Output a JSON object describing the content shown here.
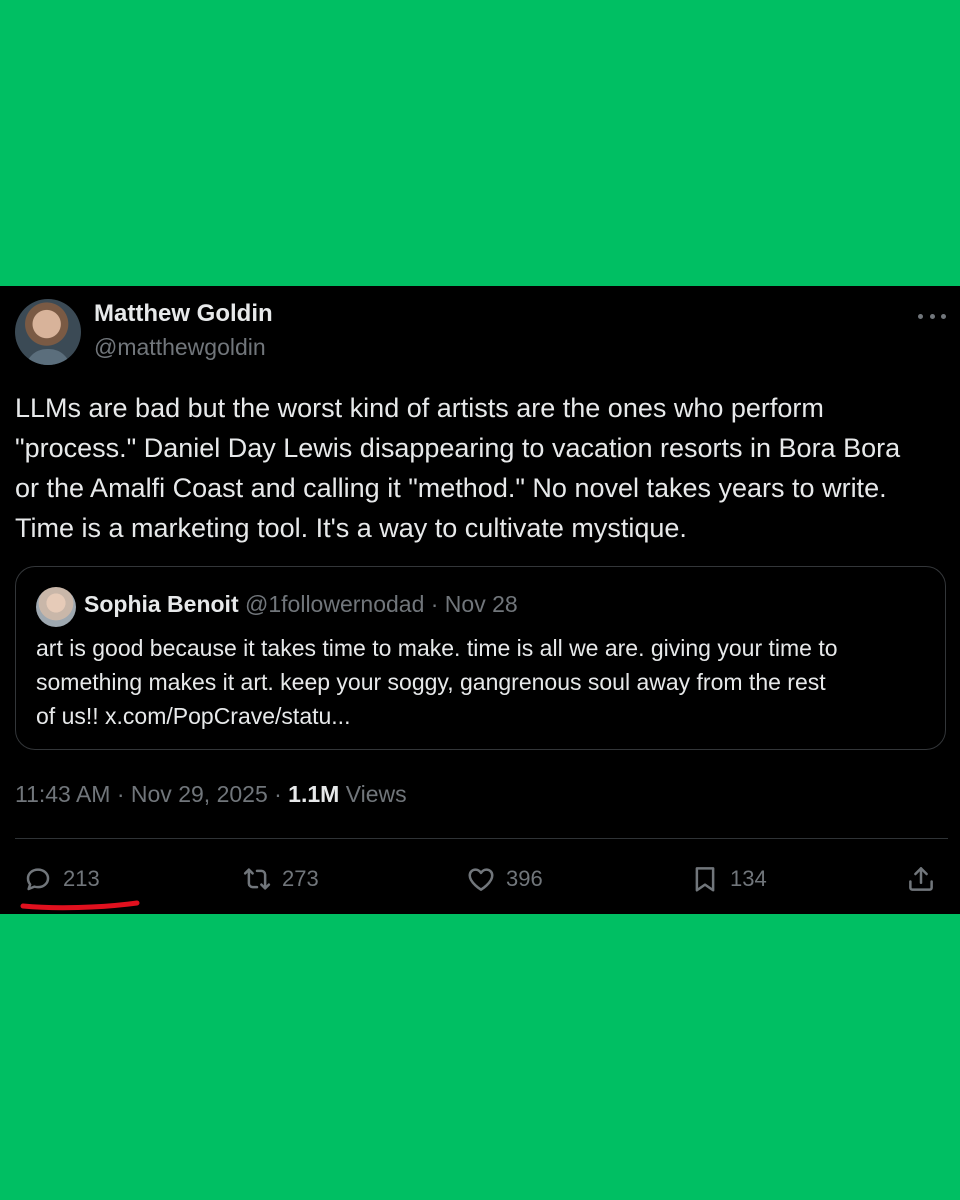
{
  "tweet": {
    "author": {
      "display_name": "Matthew Goldin",
      "handle": "@matthewgoldin"
    },
    "text": "LLMs are bad but the worst kind of artists are the ones who perform\n\"process.\" Daniel Day Lewis disappearing to vacation resorts in Bora Bora\nor the Amalfi Coast and calling it \"method.\" No novel takes years to write.\nTime is a marketing tool. It's a way to cultivate mystique.",
    "quote": {
      "display_name": "Sophia Benoit",
      "meta": "@1followernodad · Nov 28",
      "text": "art is good because it takes time to make. time is all we are. giving your time to\nsomething makes it art. keep your soggy, gangrenous soul away from the rest\nof us!! x.com/PopCrave/statu..."
    },
    "timestamp": "11:43 AM · Nov 29, 2025 · ",
    "views_count": "1.1M",
    "views_label": " Views",
    "actions": {
      "replies": "213",
      "retweets": "273",
      "likes": "396",
      "bookmarks": "134"
    },
    "icons": {
      "reply": "reply-icon",
      "retweet": "retweet-icon",
      "like": "heart-icon",
      "bookmark": "bookmark-icon",
      "share": "share-icon",
      "more": "more-icon"
    }
  },
  "colors": {
    "background": "#00bf63",
    "tweet_background": "#000000",
    "text_primary": "#e7e9ea",
    "text_secondary": "#71767b",
    "annotation_underline": "#e0101e"
  }
}
